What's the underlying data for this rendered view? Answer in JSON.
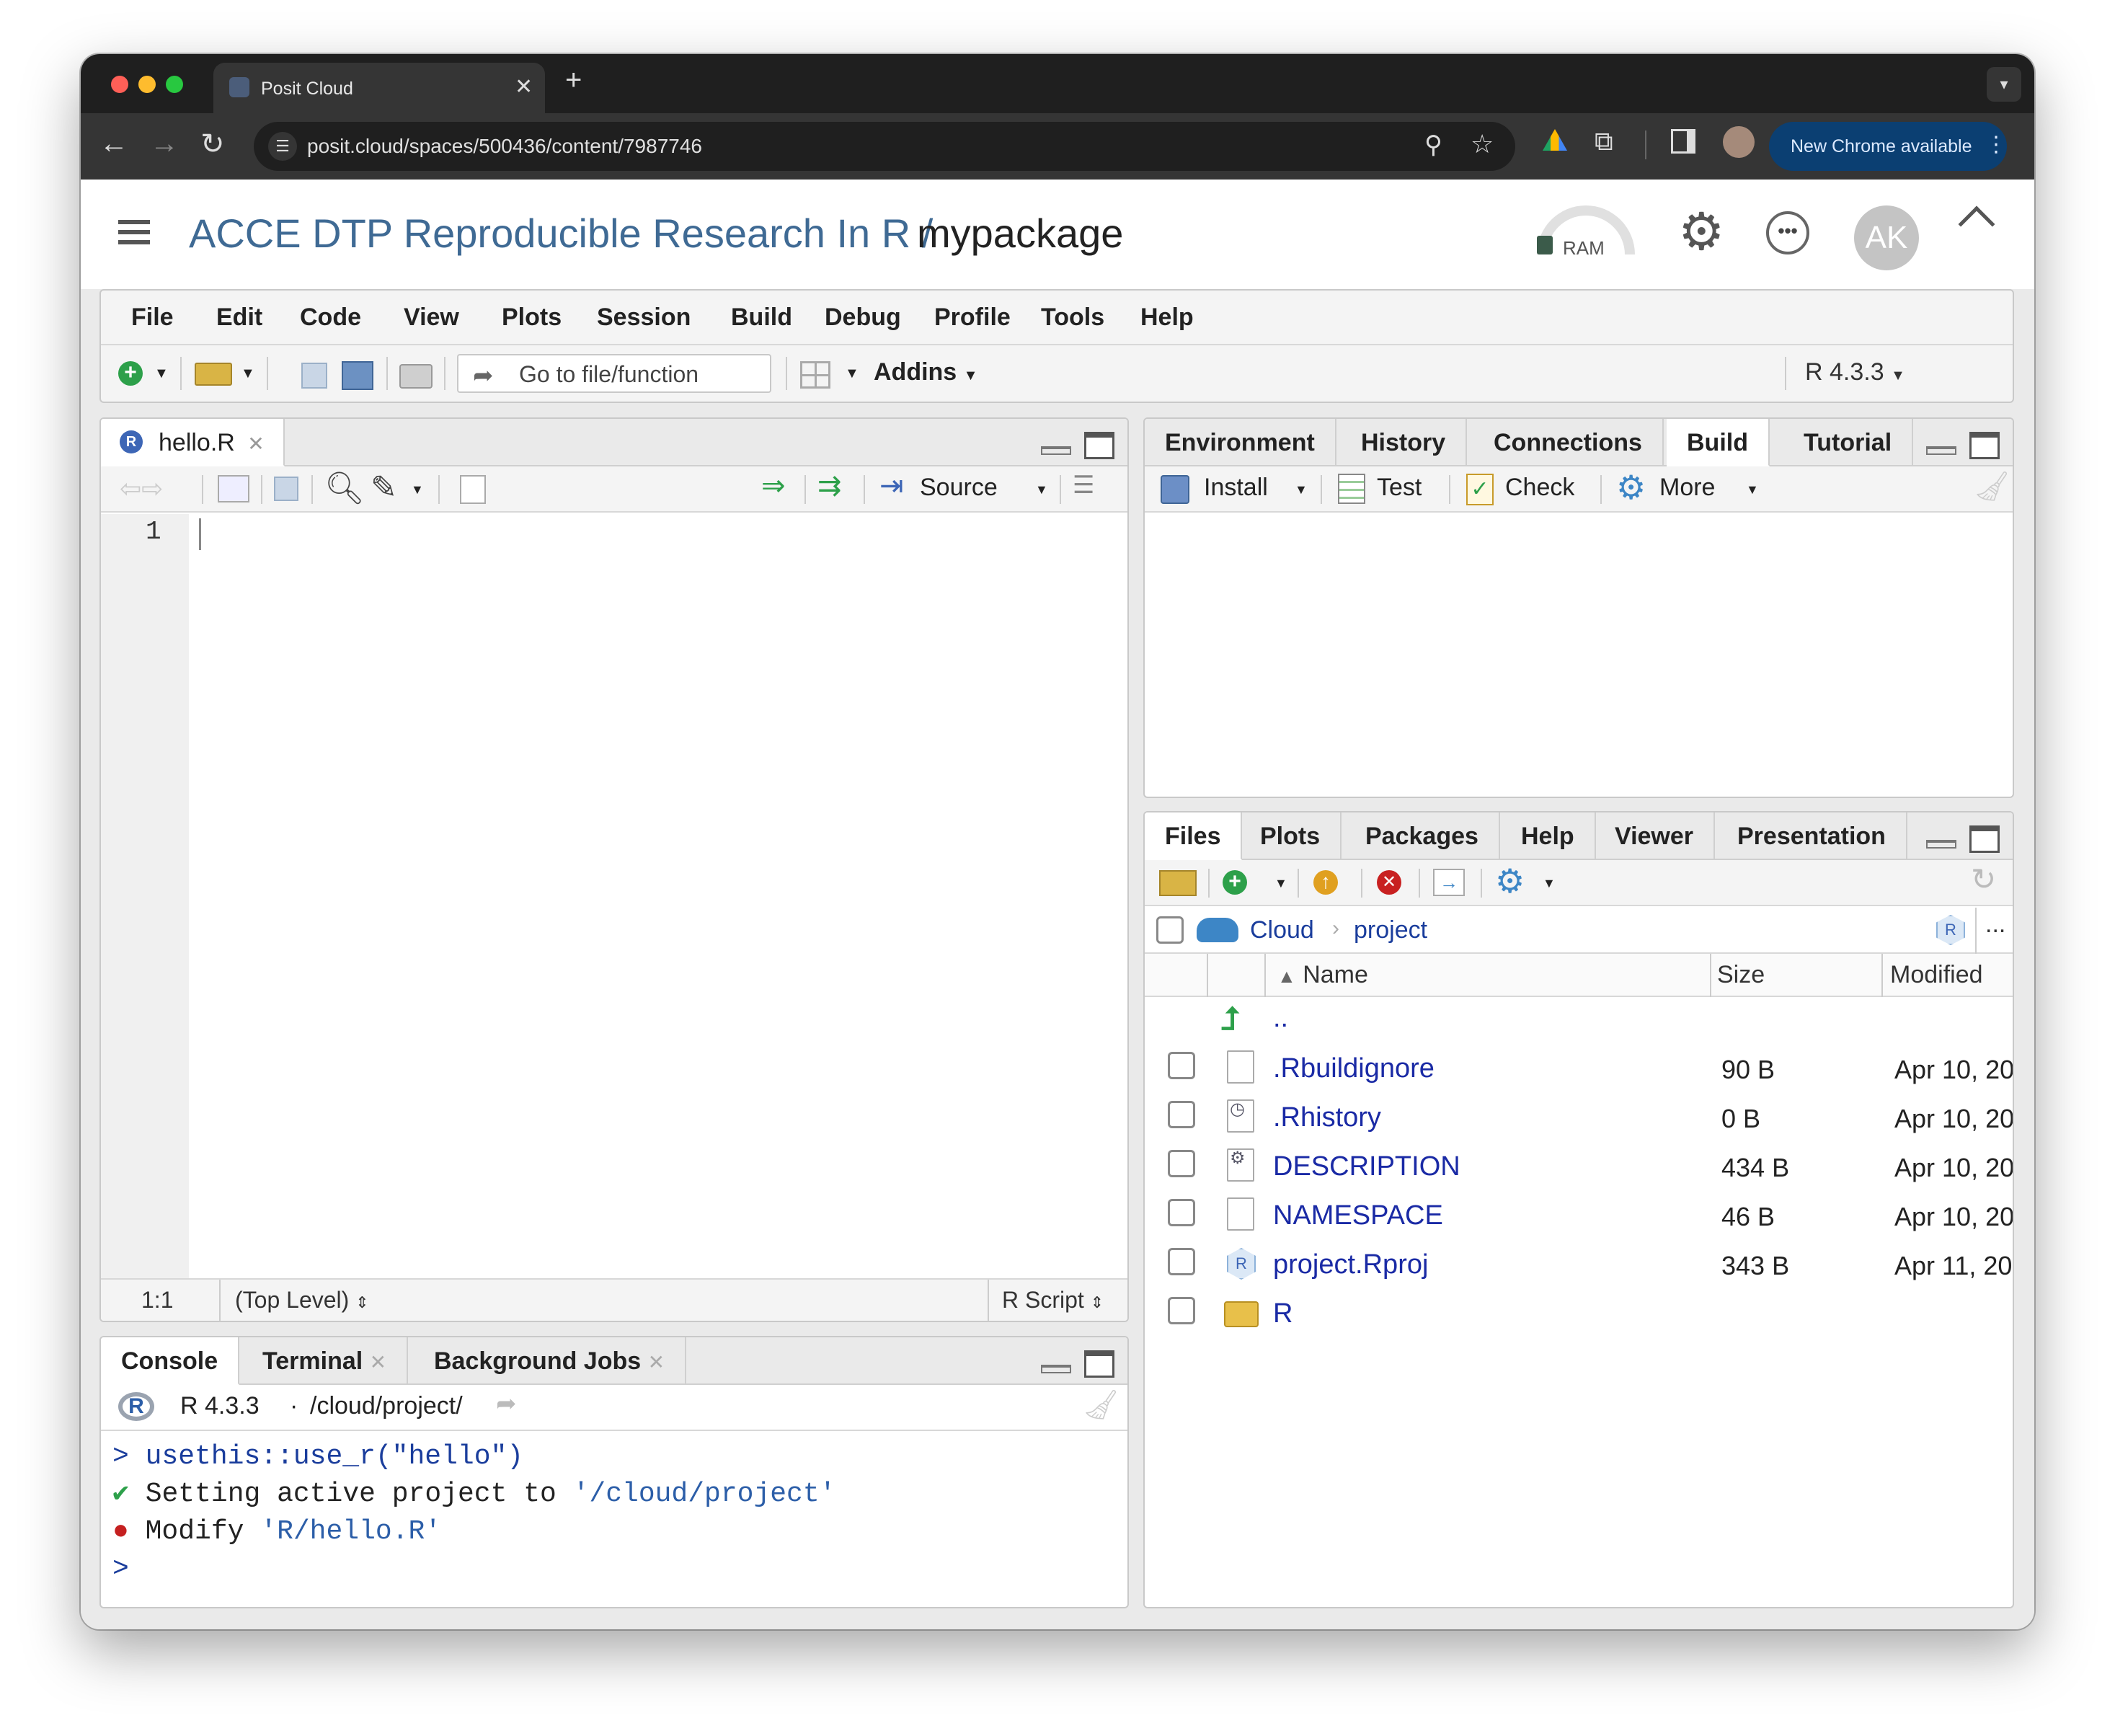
{
  "browser": {
    "tab_title": "Posit Cloud",
    "url": "posit.cloud/spaces/500436/content/7987746",
    "update_label": "New Chrome available"
  },
  "app": {
    "breadcrumb_space": "ACCE DTP Reproducible Research In R /",
    "project": "mypackage",
    "ram_label": "RAM",
    "avatar_initials": "AK"
  },
  "menubar": [
    "File",
    "Edit",
    "Code",
    "View",
    "Plots",
    "Session",
    "Build",
    "Debug",
    "Profile",
    "Tools",
    "Help"
  ],
  "toolbar": {
    "goto_placeholder": "Go to file/function",
    "addins": "Addins",
    "r_version": "R 4.3.3"
  },
  "editor": {
    "tab": "hello.R",
    "source_label": "Source",
    "line_number": "1",
    "status_pos": "1:1",
    "status_scope": "(Top Level)",
    "status_type": "R Script"
  },
  "console": {
    "tabs": [
      "Console",
      "Terminal",
      "Background Jobs"
    ],
    "version": "R 4.3.3",
    "sep": "·",
    "path": "/cloud/project/",
    "lines": [
      {
        "prefix": ">",
        "text": "usethis::use_r(\"hello\")"
      },
      {
        "prefix": "✔",
        "text": "Setting active project to ",
        "quoted": "'/cloud/project'"
      },
      {
        "prefix": "●",
        "text": "Modify ",
        "quoted": "'R/hello.R'"
      },
      {
        "prefix": ">",
        "text": ""
      }
    ]
  },
  "env_pane": {
    "tabs": [
      "Environment",
      "History",
      "Connections",
      "Build",
      "Tutorial"
    ],
    "active_tab": "Build",
    "buttons": [
      "Install",
      "Test",
      "Check",
      "More"
    ]
  },
  "files_pane": {
    "tabs": [
      "Files",
      "Plots",
      "Packages",
      "Help",
      "Viewer",
      "Presentation"
    ],
    "path": [
      "Cloud",
      "project"
    ],
    "more": "...",
    "columns": [
      "Name",
      "Size",
      "Modified"
    ],
    "parent": "..",
    "rows": [
      {
        "name": ".Rbuildignore",
        "size": "90 B",
        "modified": "Apr 10, 20",
        "icon": "file-icon"
      },
      {
        "name": ".Rhistory",
        "size": "0 B",
        "modified": "Apr 10, 20",
        "icon": "history-file-icon"
      },
      {
        "name": "DESCRIPTION",
        "size": "434 B",
        "modified": "Apr 10, 20",
        "icon": "description-file-icon"
      },
      {
        "name": "NAMESPACE",
        "size": "46 B",
        "modified": "Apr 10, 20",
        "icon": "file-icon"
      },
      {
        "name": "project.Rproj",
        "size": "343 B",
        "modified": "Apr 11, 20",
        "icon": "rproj-file-icon"
      },
      {
        "name": "R",
        "size": "",
        "modified": "",
        "icon": "folder-icon"
      }
    ]
  }
}
